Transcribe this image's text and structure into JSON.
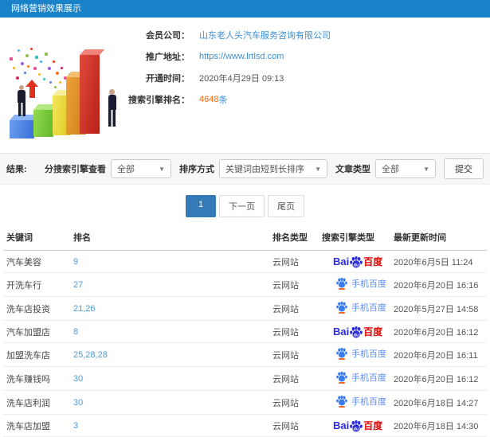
{
  "header": {
    "title": "网络营销效果展示"
  },
  "info": {
    "company_label": "会员公司：",
    "company_value": "山东老人头汽车服务咨询有限公司",
    "url_label": "推广地址：",
    "url_value": "https://www.lrtlsd.com",
    "open_label": "开通时间：",
    "open_value": "2020年4月29日 09:13",
    "rank_label": "搜索引擎排名：",
    "rank_count": "4648",
    "rank_unit": "条"
  },
  "filters": {
    "result_label": "结果:",
    "engine_label": "分搜索引擎查看",
    "engine_value": "全部",
    "sort_label": "排序方式",
    "sort_value": "关键词由短到长排序",
    "article_label": "文章类型",
    "article_value": "全部",
    "submit_label": "提交"
  },
  "pagination": {
    "current": "1",
    "next": "下一页",
    "last": "尾页"
  },
  "table": {
    "headers": [
      "关键词",
      "排名",
      "排名类型",
      "搜索引擎类型",
      "最新更新时间"
    ],
    "baidu_logo": {
      "bai": "Bai",
      "du": "du",
      "brand": "百度"
    },
    "mobile_label": "手机百度",
    "rows": [
      {
        "keyword": "汽车美容",
        "rank": "9",
        "rank_type": "云网站",
        "engine": "baidu",
        "updated": "2020年6月5日 11:24"
      },
      {
        "keyword": "开洗车行",
        "rank": "27",
        "rank_type": "云网站",
        "engine": "mobile-baidu",
        "updated": "2020年6月20日 16:16"
      },
      {
        "keyword": "洗车店投资",
        "rank": "21,26",
        "rank_type": "云网站",
        "engine": "mobile-baidu",
        "updated": "2020年5月27日 14:58"
      },
      {
        "keyword": "汽车加盟店",
        "rank": "8",
        "rank_type": "云网站",
        "engine": "baidu",
        "updated": "2020年6月20日 16:12"
      },
      {
        "keyword": "加盟洗车店",
        "rank": "25,28,28",
        "rank_type": "云网站",
        "engine": "mobile-baidu",
        "updated": "2020年6月20日 16:11"
      },
      {
        "keyword": "洗车赚钱吗",
        "rank": "30",
        "rank_type": "云网站",
        "engine": "mobile-baidu",
        "updated": "2020年6月20日 16:12"
      },
      {
        "keyword": "洗车店利润",
        "rank": "30",
        "rank_type": "云网站",
        "engine": "mobile-baidu",
        "updated": "2020年6月18日 14:27"
      },
      {
        "keyword": "洗车店加盟",
        "rank": "3",
        "rank_type": "云网站",
        "engine": "baidu",
        "updated": "2020年6月18日 14:30"
      }
    ]
  },
  "colors": {
    "header_blue": "#1a82c8",
    "link_blue": "#3a8fd6",
    "rank_blue": "#4d9bd5",
    "highlight_orange": "#ff6600",
    "active_page_blue": "#337ab7",
    "baidu_blue": "#2c2cd8",
    "baidu_red": "#e60000",
    "mobile_baidu_blue": "#5b8bf0"
  }
}
